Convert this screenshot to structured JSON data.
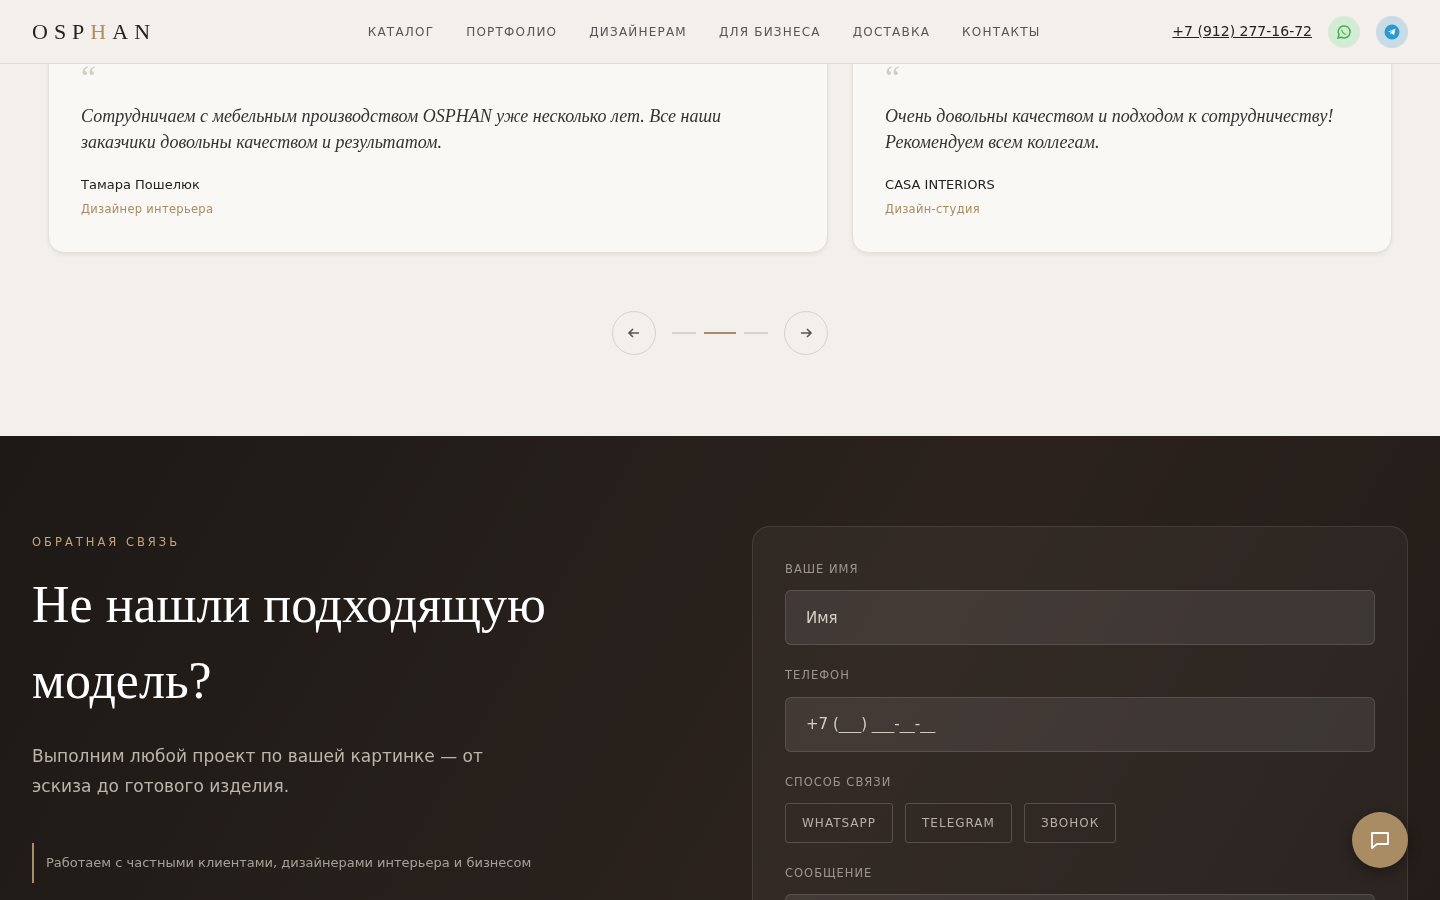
{
  "header": {
    "logo": [
      {
        "text": "OSP",
        "accent": false
      },
      {
        "text": "H",
        "accent": true
      },
      {
        "text": "AN",
        "accent": false
      }
    ],
    "nav": [
      "КАТАЛОГ",
      "ПОРТФОЛИО",
      "ДИЗАЙНЕРАМ",
      "ДЛЯ БИЗНЕСА",
      "ДОСТАВКА",
      "КОНТАКТЫ"
    ],
    "phone": "+7 (912) 277-16-72"
  },
  "testimonials": [
    {
      "quote_mark": "“",
      "text": "Сотрудничаем с мебельным производством OSPHAN уже несколько лет. Все наши заказчики довольны качеством и результатом.",
      "author": "Тамара Пошелюк",
      "role": "Дизайнер интерьера"
    },
    {
      "quote_mark": "“",
      "text": "Очень довольны качеством и подходом к сотрудничеству! Рекомендуем всем коллегам.",
      "author": "CASA INTERIORS",
      "role": "Дизайн-студия"
    }
  ],
  "pager": [
    {
      "selected": false
    },
    {
      "selected": true
    },
    {
      "selected": false
    }
  ],
  "feedback": {
    "eyebrow": "ОБРАТНАЯ СВЯЗЬ",
    "title": "Не нашли подходящую модель?",
    "lead": "Выполним любой проект по вашей картинке — от эскиза до готового изделия.",
    "points": [
      "Работаем с частными клиентами, дизайнерами интерьера и бизнесом"
    ],
    "form": {
      "name_label": "ВАШЕ ИМЯ",
      "name_placeholder": "Имя",
      "phone_label": "ТЕЛЕФОН",
      "phone_placeholder": "+7 (___) ___-__-__",
      "method_label": "СПОСОБ СВЯЗИ",
      "methods": [
        "WHATSAPP",
        "TELEGRAM",
        "ЗВОНОК"
      ],
      "message_label": "СООБЩЕНИЕ"
    }
  }
}
